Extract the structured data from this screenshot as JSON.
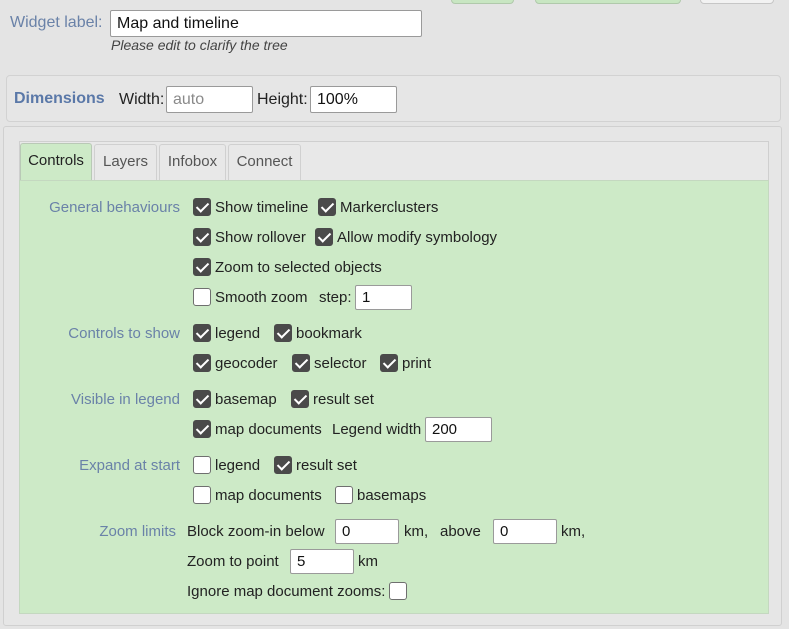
{
  "widget": {
    "label_text": "Widget label:",
    "value": "Map and timeline",
    "hint": "Please edit to clarify the tree"
  },
  "dimensions": {
    "title": "Dimensions",
    "width_label": "Width:",
    "width_placeholder": "auto",
    "height_label": "Height:",
    "height_value": "100%"
  },
  "tabs": [
    "Controls",
    "Layers",
    "Infobox",
    "Connect"
  ],
  "active_tab": "Controls",
  "controls": {
    "general": {
      "label": "General behaviours",
      "show_timeline": {
        "label": "Show timeline",
        "checked": true
      },
      "markerclusters": {
        "label": "Markerclusters",
        "checked": true
      },
      "show_rollover": {
        "label": "Show rollover",
        "checked": true
      },
      "allow_modify": {
        "label": "Allow modify symbology",
        "checked": true
      },
      "zoom_selected": {
        "label": "Zoom to selected objects",
        "checked": true
      },
      "smooth_zoom": {
        "label": "Smooth zoom",
        "checked": false
      },
      "step_label": "step:",
      "step_value": "1"
    },
    "show": {
      "label": "Controls to show",
      "legend": {
        "label": "legend",
        "checked": true
      },
      "bookmark": {
        "label": "bookmark",
        "checked": true
      },
      "geocoder": {
        "label": "geocoder",
        "checked": true
      },
      "selector": {
        "label": "selector",
        "checked": true
      },
      "print": {
        "label": "print",
        "checked": true
      }
    },
    "visible": {
      "label": "Visible in legend",
      "basemap": {
        "label": "basemap",
        "checked": true
      },
      "result_set": {
        "label": "result set",
        "checked": true
      },
      "map_documents": {
        "label": "map documents",
        "checked": true
      },
      "legend_width_label": "Legend width",
      "legend_width_value": "200"
    },
    "expand": {
      "label": "Expand at start",
      "legend": {
        "label": "legend",
        "checked": false
      },
      "result_set": {
        "label": "result set",
        "checked": true
      },
      "map_documents": {
        "label": "map documents",
        "checked": false
      },
      "basemaps": {
        "label": "basemaps",
        "checked": false
      }
    },
    "zoom": {
      "label": "Zoom limits",
      "block_label": "Block zoom-in below",
      "block_value": "0",
      "km1": "km,",
      "above_label": "above",
      "above_value": "0",
      "km2": "km,",
      "point_label": "Zoom to point",
      "point_value": "5",
      "km3": "km",
      "ignore_label": "Ignore map document zooms:",
      "ignore_checked": false
    }
  },
  "colors": {
    "label_blue": "#6a82a8",
    "panel_green": "#cdeac7",
    "checkbox_dark": "#4a4a4a"
  }
}
